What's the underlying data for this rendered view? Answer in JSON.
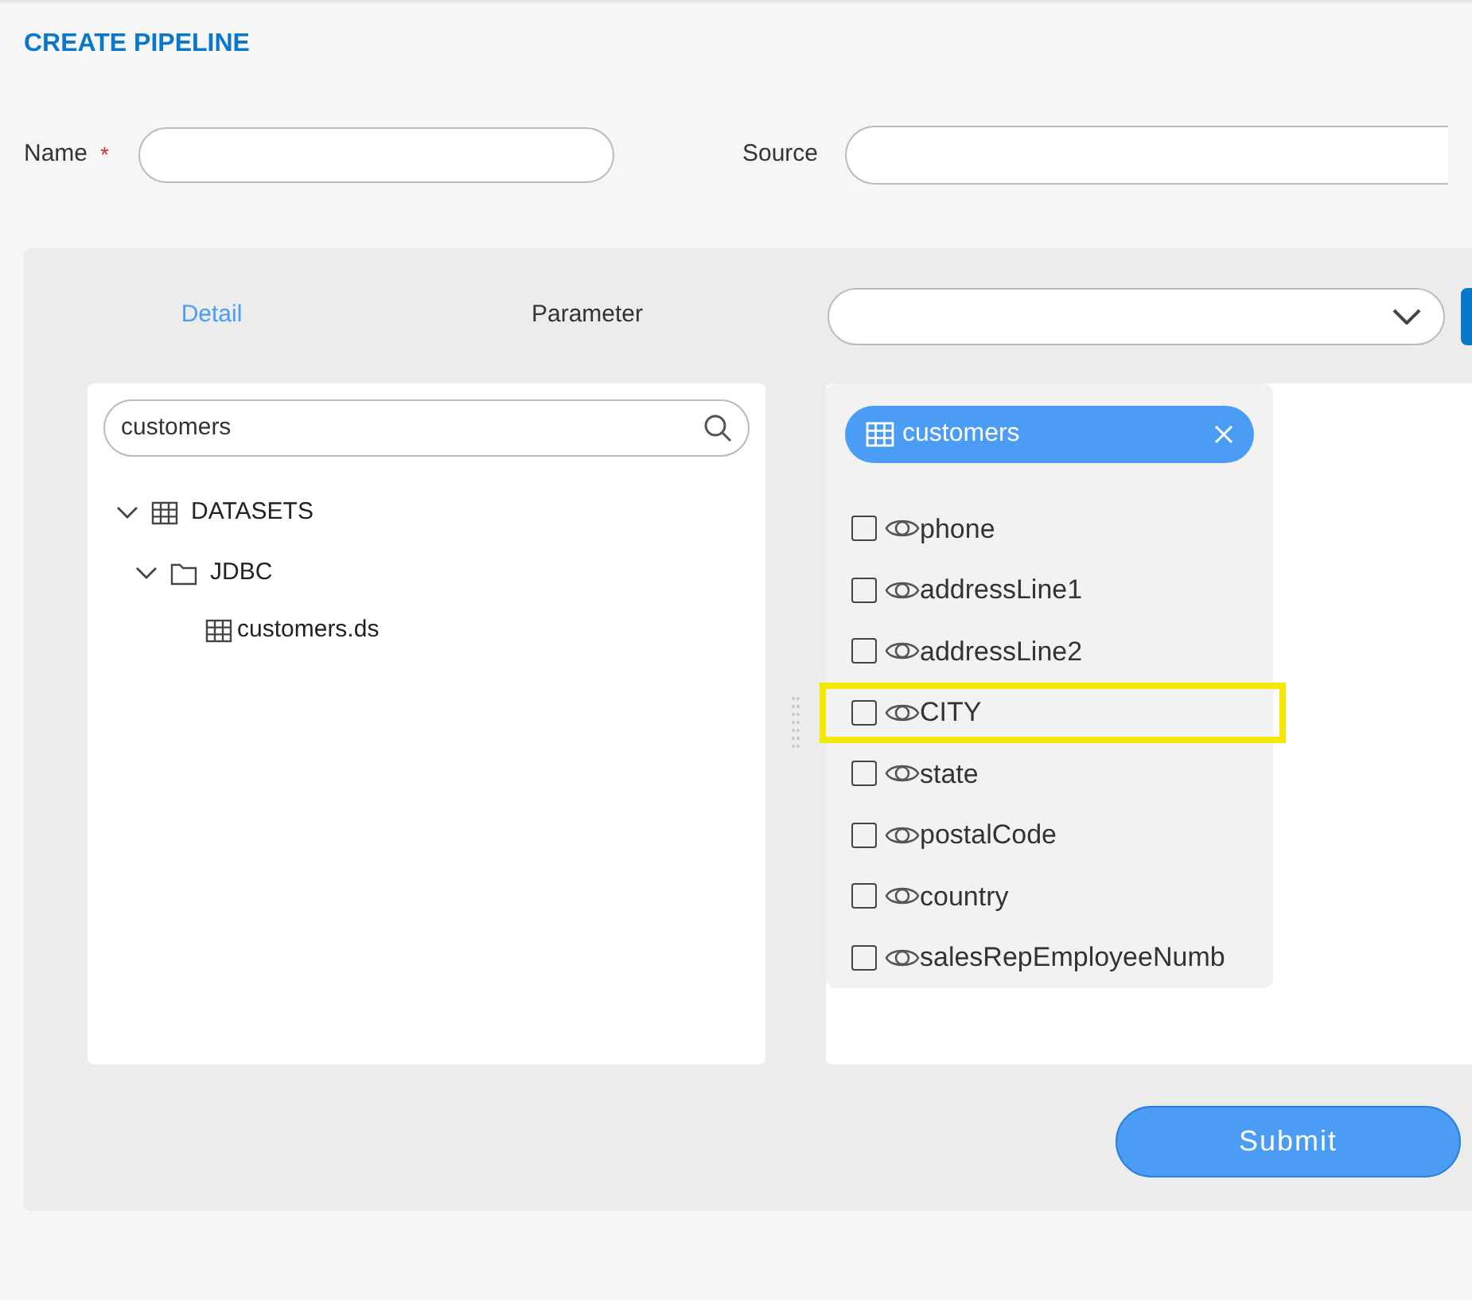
{
  "title": "CREATE PIPELINE",
  "form": {
    "name_label": "Name",
    "required_mark": "*",
    "source_label": "Source"
  },
  "tabs": [
    {
      "label": "Detail",
      "selected": true
    },
    {
      "label": "Parameter",
      "selected": false
    }
  ],
  "search": {
    "value": "customers"
  },
  "tree": [
    {
      "label": "DATASETS",
      "kind": "group",
      "expanded": true,
      "children": [
        {
          "label": "JDBC",
          "kind": "folder",
          "expanded": true,
          "children": [
            {
              "label": "customers.ds",
              "kind": "dataset"
            }
          ]
        }
      ]
    }
  ],
  "selected_table": {
    "label": "customers"
  },
  "fields": [
    {
      "label": "phone",
      "checked": false,
      "highlighted": false
    },
    {
      "label": "addressLine1",
      "checked": false,
      "highlighted": false
    },
    {
      "label": "addressLine2",
      "checked": false,
      "highlighted": false
    },
    {
      "label": "CITY",
      "checked": false,
      "highlighted": true
    },
    {
      "label": "state",
      "checked": false,
      "highlighted": false
    },
    {
      "label": "postalCode",
      "checked": false,
      "highlighted": false
    },
    {
      "label": "country",
      "checked": false,
      "highlighted": false
    },
    {
      "label": "salesRepEmployeeNumb",
      "checked": false,
      "highlighted": false
    }
  ],
  "submit": "Submit"
}
